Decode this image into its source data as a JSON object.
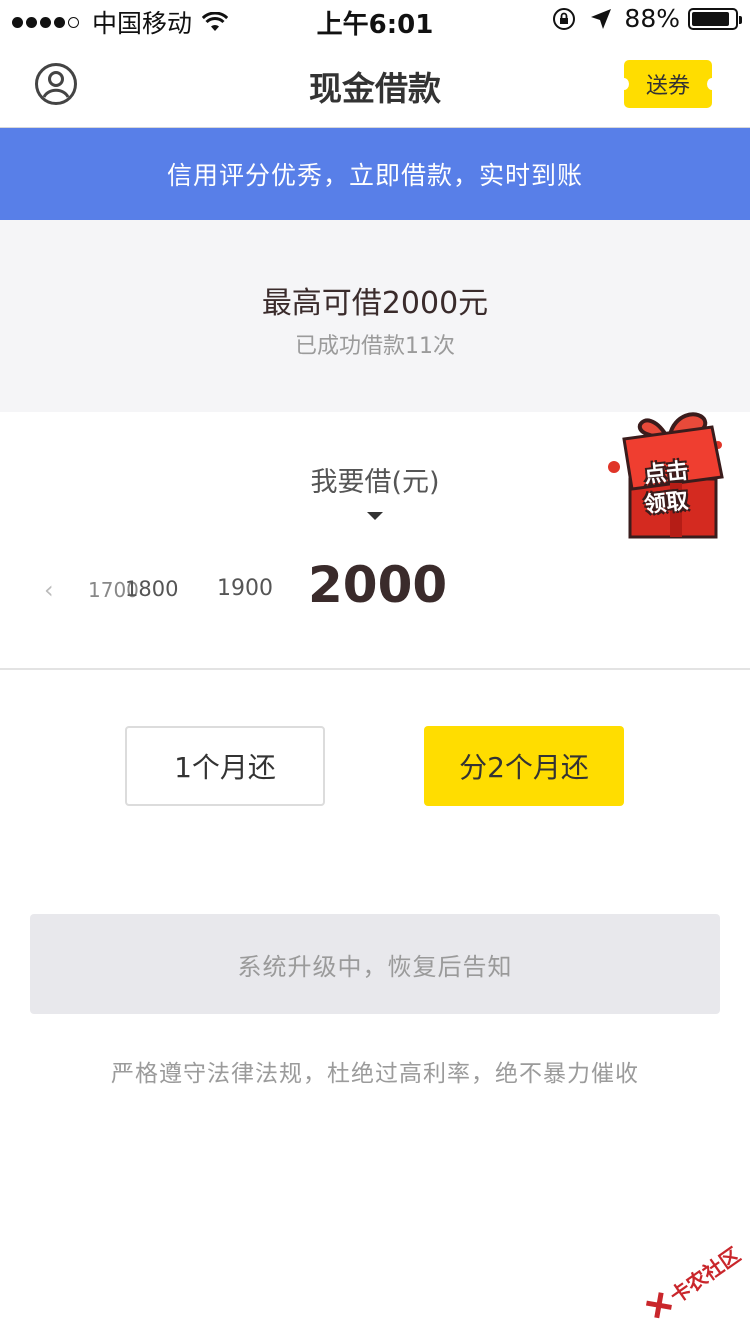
{
  "status_bar": {
    "carrier": "中国移动",
    "time": "上午6:01",
    "battery": "88%",
    "battery_level": 0.88
  },
  "nav": {
    "title": "现金借款",
    "coupon_label": "送券"
  },
  "banner": {
    "text": "信用评分优秀，立即借款，实时到账"
  },
  "limit": {
    "title": "最高可借2000元",
    "subtitle": "已成功借款11次"
  },
  "amount": {
    "label": "我要借(元)",
    "options": [
      "1700",
      "1800",
      "1900"
    ],
    "selected": "2000"
  },
  "promo": {
    "line1": "点击",
    "line2": "领取"
  },
  "repay": {
    "option1": "1个月还",
    "option2": "分2个月还",
    "selected_index": 1
  },
  "submit": {
    "label": "系统升级中，恢复后告知"
  },
  "footer": {
    "note": "严格遵守法律法规，杜绝过高利率，绝不暴力催收"
  },
  "watermark": {
    "text": "卡农社区"
  },
  "colors": {
    "accent_yellow": "#ffdd00",
    "banner_blue": "#587fe8",
    "gift_red": "#e03528"
  }
}
